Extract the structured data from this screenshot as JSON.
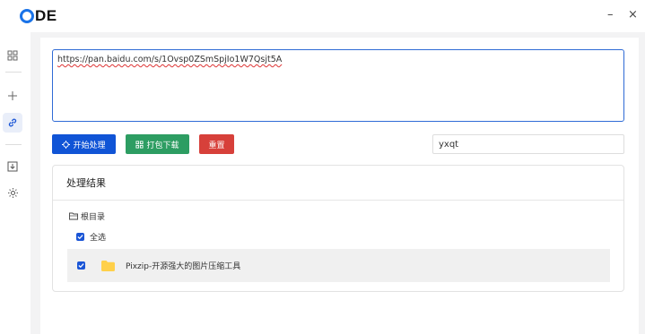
{
  "app": {
    "logo_text": "DE"
  },
  "window": {
    "minimize": "–",
    "close": "×"
  },
  "sidebar": {
    "items": [
      {
        "name": "grid-icon"
      },
      {
        "name": "plus-icon"
      },
      {
        "name": "link-icon",
        "active": true
      },
      {
        "name": "download-icon"
      },
      {
        "name": "gear-icon"
      }
    ]
  },
  "input": {
    "url": "https://pan.baidu.com/s/1Ovsp0ZSmSpjIo1W7Qsjt5A"
  },
  "actions": {
    "start_label": "开始处理",
    "pack_label": "打包下载",
    "reset_label": "重置"
  },
  "password": {
    "value": "yxqt"
  },
  "result": {
    "title": "处理结果",
    "root_label": "根目录",
    "select_all_label": "全选",
    "files": [
      {
        "name": "Pixzip-开源强大的图片压缩工具",
        "checked": true
      }
    ]
  },
  "colors": {
    "primary": "#1054d6",
    "success": "#2d9d62",
    "danger": "#d7403a"
  }
}
